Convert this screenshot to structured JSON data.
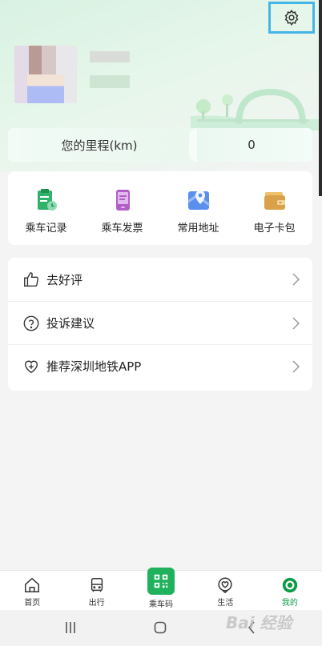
{
  "header": {
    "settings_icon": "gear-icon"
  },
  "mileage": {
    "label": "您的里程(km)",
    "value": "0"
  },
  "quick_actions": [
    {
      "label": "乘车记录",
      "icon": "ride-record-icon"
    },
    {
      "label": "乘车发票",
      "icon": "invoice-icon"
    },
    {
      "label": "常用地址",
      "icon": "map-pin-icon"
    },
    {
      "label": "电子卡包",
      "icon": "wallet-icon"
    }
  ],
  "menu": [
    {
      "label": "去好评",
      "icon": "thumbs-up-icon"
    },
    {
      "label": "投诉建议",
      "icon": "question-circle-icon"
    },
    {
      "label": "推荐深圳地铁APP",
      "icon": "heart-plus-icon"
    }
  ],
  "tabbar": [
    {
      "label": "首页",
      "icon": "home-icon"
    },
    {
      "label": "出行",
      "icon": "bus-icon"
    },
    {
      "label": "乘车码",
      "icon": "qr-code-icon"
    },
    {
      "label": "生活",
      "icon": "heart-location-icon"
    },
    {
      "label": "我的",
      "icon": "profile-icon",
      "active": true
    }
  ],
  "colors": {
    "accent": "#0b9a45",
    "qr_bg": "#20b15c",
    "highlight_border": "#45b5e8"
  },
  "watermark": "Bai 经验"
}
